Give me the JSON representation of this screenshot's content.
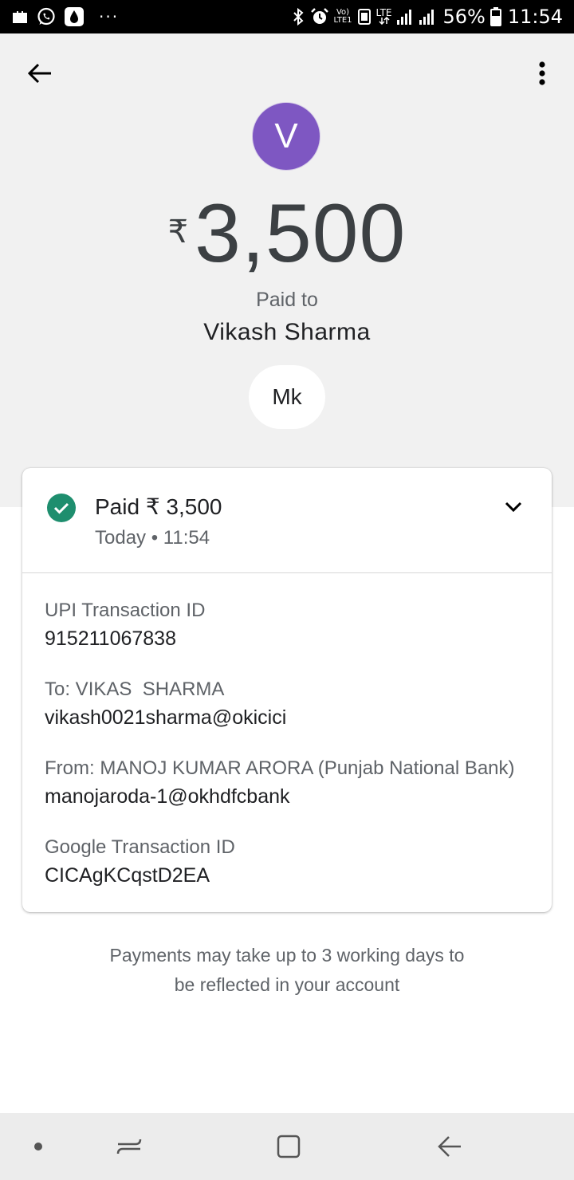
{
  "status_bar": {
    "battery_percent": "56%",
    "time": "11:54",
    "dots": "···",
    "volte_top": "Vo)",
    "volte_bottom": "LTE1",
    "lte": "LTE"
  },
  "header": {
    "avatar_letter": "V",
    "avatar_color": "#7e57c2"
  },
  "payment": {
    "currency_symbol": "₹",
    "amount": "3,500",
    "paid_to_label": "Paid to",
    "payee_name": "Vikash Sharma",
    "note": "Mk"
  },
  "card": {
    "status_title": "Paid ₹ 3,500",
    "status_time": "Today • 11:54",
    "status_color": "#1e8e6e",
    "details": [
      {
        "label": "UPI Transaction ID",
        "value": "915211067838"
      },
      {
        "label": "To: VIKAS  SHARMA",
        "value": "vikash0021sharma@okicici"
      },
      {
        "label": "From: MANOJ KUMAR ARORA (Punjab National Bank)",
        "value": "manojaroda-1@okhdfcbank"
      },
      {
        "label": "Google Transaction ID",
        "value": "CICAgKCqstD2EA"
      }
    ]
  },
  "footer": {
    "line1": "Payments may take up to 3 working days to",
    "line2": "be reflected in your account"
  }
}
